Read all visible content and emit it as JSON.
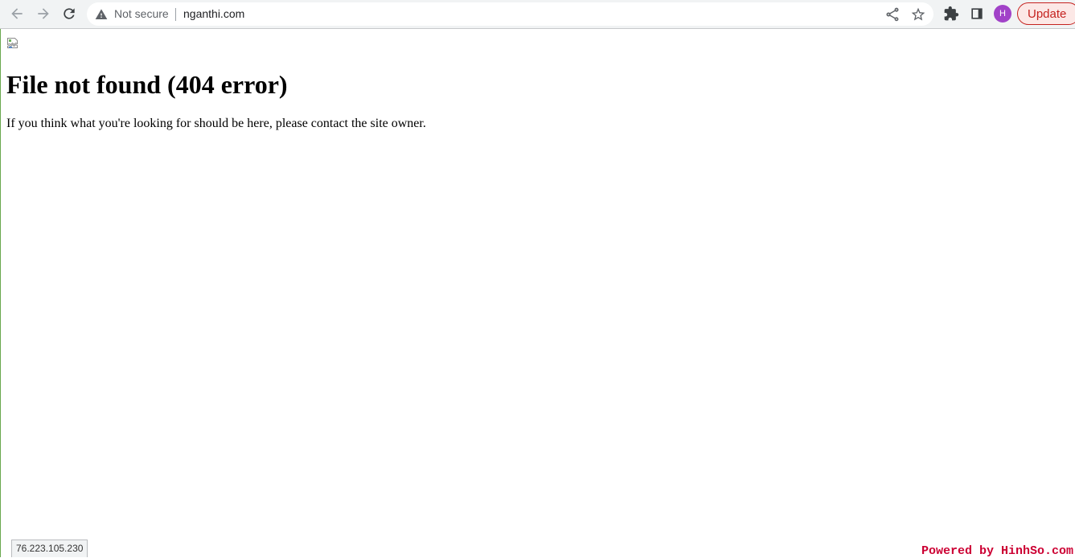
{
  "browser": {
    "security_label": "Not secure",
    "url": "nganthi.com",
    "avatar_initial": "H",
    "update_label": "Update",
    "icons": {
      "back": "arrow-left-icon",
      "forward": "arrow-right-icon",
      "reload": "reload-icon",
      "security": "warning-triangle-icon",
      "share": "share-icon",
      "bookmark": "star-icon",
      "extensions": "puzzle-icon",
      "side_panel": "side-panel-icon"
    }
  },
  "page": {
    "heading": "File not found (404 error)",
    "message": "If you think what you're looking for should be here, please contact the site owner.",
    "broken_image_icon": "broken-image-icon"
  },
  "status_bar": {
    "link_text": "76.223.105.230"
  },
  "watermark": {
    "text": "Powered by HinhSo.com"
  },
  "colors": {
    "toolbar_bg": "#f1f3f4",
    "update_accent": "#c5221f",
    "avatar_bg": "#a142c8",
    "watermark": "#cc0033"
  }
}
